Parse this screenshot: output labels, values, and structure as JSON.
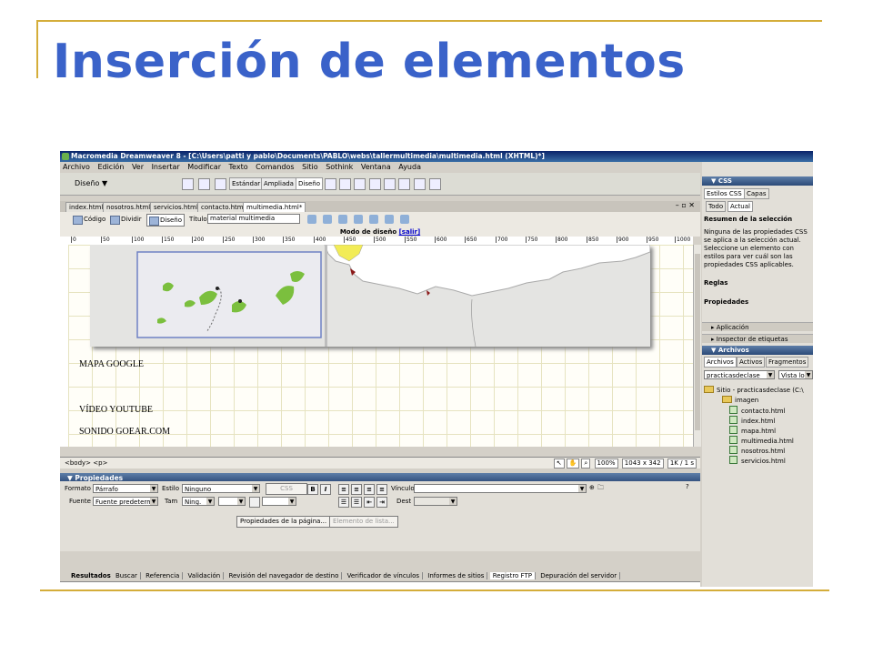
{
  "slide": {
    "title": "Inserción de elementos"
  },
  "window": {
    "title": "Macromedia Dreamweaver 8 - [C:\\Users\\patti y pablo\\Documents\\PABLO\\webs\\tallermultimedia\\multimedia.html (XHTML)*]",
    "menu": [
      "Archivo",
      "Edición",
      "Ver",
      "Insertar",
      "Modificar",
      "Texto",
      "Comandos",
      "Sitio",
      "Sothink",
      "Ventana",
      "Ayuda"
    ]
  },
  "insertbar": {
    "menu_label": "Diseño",
    "segments": [
      "Estándar",
      "Ampliada",
      "Diseño"
    ]
  },
  "doc_tabs": [
    "index.html",
    "nosotros.html",
    "servicios.html",
    "contacto.html",
    "multimedia.html*"
  ],
  "doc_toolbar": {
    "code": "Código",
    "split": "Dividir",
    "design": "Diseño",
    "title_label": "Título:",
    "title_value": "material multimedia"
  },
  "design_mode": {
    "label": "Modo de diseño",
    "link": "[salir]"
  },
  "ruler": [
    "0",
    "50",
    "100",
    "150",
    "200",
    "250",
    "300",
    "350",
    "400",
    "450",
    "500",
    "550",
    "600",
    "650",
    "700",
    "750",
    "800",
    "850",
    "900",
    "950",
    "1000"
  ],
  "content": [
    "MAPA GOOGLE",
    "VÍDEO YOUTUBE",
    "SONIDO GOEAR.COM"
  ],
  "status": {
    "tags": "<body> <p>",
    "zoom": "100%",
    "size": "1043 x 342",
    "weight": "1K / 1 s"
  },
  "properties": {
    "header": "Propiedades",
    "formato_label": "Formato",
    "formato_value": "Párrafo",
    "estilo_label": "Estilo",
    "estilo_value": "Ninguno",
    "css_btn": "CSS",
    "bold": "B",
    "italic": "I",
    "vinculo_label": "Vínculo",
    "fuente_label": "Fuente",
    "fuente_value": "Fuente predeterm",
    "tam_label": "Tam",
    "tam_value": "Ning.",
    "dest_label": "Dest",
    "page_props_btn": "Propiedades de la página...",
    "list_item_btn": "Elemento de lista..."
  },
  "results": {
    "header": "Resultados",
    "tabs": [
      "Buscar",
      "Referencia",
      "Validación",
      "Revisión del navegador de destino",
      "Verificador de vínculos",
      "Informes de sitios",
      "Registro FTP",
      "Depuración del servidor"
    ]
  },
  "css_panel": {
    "header": "CSS",
    "tabs": [
      "Estilos CSS",
      "Capas"
    ],
    "subtabs": [
      "Todo",
      "Actual"
    ],
    "summary_title": "Resumen de la selección",
    "summary_text": "Ninguna de las propiedades CSS se aplica a la selección actual. Seleccione un elemento con estilos para ver cuál son las propiedades CSS aplicables.",
    "rules": "Reglas",
    "properties": "Propiedades"
  },
  "panels": {
    "application": "Aplicación",
    "tag_inspector": "Inspector de etiquetas",
    "files": "Archivos"
  },
  "files_panel": {
    "tabs": [
      "Archivos",
      "Activos",
      "Fragmentos"
    ],
    "site_select": "practicasdeclase",
    "view_select": "Vista local",
    "site_root": "Sitio - practicasdeclase (C:\\",
    "items": [
      "imagen",
      "contacto.html",
      "index.html",
      "mapa.html",
      "multimedia.html",
      "nosotros.html",
      "servicios.html"
    ]
  },
  "colors": {
    "title": "#3a62c9",
    "accent_line": "#d4ad3a",
    "titlebar": "#0a246a"
  }
}
